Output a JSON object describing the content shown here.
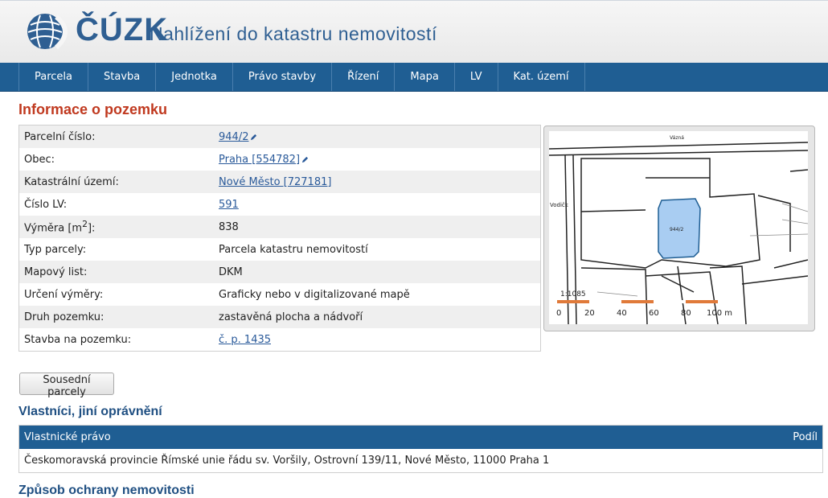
{
  "header": {
    "logo_text": "ČÚZK",
    "title": "Nahlížení do katastru nemovitostí"
  },
  "nav": {
    "items": [
      {
        "label": "Parcela"
      },
      {
        "label": "Stavba"
      },
      {
        "label": "Jednotka"
      },
      {
        "label": "Právo stavby"
      },
      {
        "label": "Řízení"
      },
      {
        "label": "Mapa"
      },
      {
        "label": "LV"
      },
      {
        "label": "Kat. území"
      }
    ]
  },
  "info": {
    "title": "Informace o pozemku",
    "rows": [
      {
        "label": "Parcelní číslo:",
        "value": "944/2",
        "link": true
      },
      {
        "label": "Obec:",
        "value": "Praha [554782]",
        "link": true
      },
      {
        "label": "Katastrální území:",
        "value": "Nové Město [727181]",
        "link": true
      },
      {
        "label": "Číslo LV:",
        "value": "591",
        "link": true
      },
      {
        "label_main": "Výměra [m",
        "label_sup": "2",
        "label_end": "]:",
        "value": "838",
        "link": false
      },
      {
        "label": "Typ parcely:",
        "value": "Parcela katastru nemovitostí",
        "link": false
      },
      {
        "label": "Mapový list:",
        "value": "DKM",
        "link": false
      },
      {
        "label": "Určení výměry:",
        "value": "Graficky nebo v digitalizované mapě",
        "link": false
      },
      {
        "label": "Druh pozemku:",
        "value": "zastavěná plocha a nádvoří",
        "link": false
      },
      {
        "label": "Stavba na pozemku:",
        "value": "č. p. 1435",
        "link": true
      }
    ]
  },
  "map": {
    "scale_labels": [
      "0",
      "20",
      "40",
      "60",
      "80",
      "100 m"
    ],
    "labels": {
      "street_left": "Vodičk",
      "street_top": "Vázná",
      "parcel": "944/2",
      "scale_top": "1:1085"
    },
    "highlight_color": "#a9cdf2",
    "scale_color": "#e07a3a"
  },
  "neighbors_button": "Sousední parcely",
  "owners": {
    "title": "Vlastníci, jiní oprávnění",
    "header_left": "Vlastnické právo",
    "header_right": "Podíl",
    "rows": [
      {
        "name": "Českomoravská provincie Římské unie řádu sv. Voršily, Ostrovní 139/11, Nové Město, 11000 Praha 1"
      }
    ]
  },
  "next_section_title": "Způsob ochrany nemovitosti"
}
